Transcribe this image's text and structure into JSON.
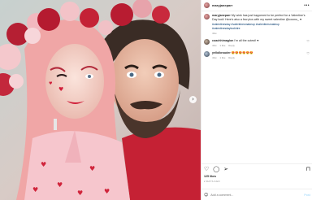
{
  "post": {
    "author": "maryjaneparr",
    "caption_user": "maryjaneparr",
    "caption_text": "My wink has just happened to be perfect for a Valentine's Day look! Here's also a few pics with my sweet valentine @cosmo_ ♥",
    "hashtags": "#valentinesday #valentinesmakeup #valentinesmakeup #valentinesdaylookhire",
    "caption_time": "43w",
    "comments": [
      {
        "user": "coachhimaglon",
        "text": "I'm all the cutest! ♥",
        "time": "43w",
        "likes": "1 like",
        "reply": "Reply"
      },
      {
        "user": "yellolbrouder",
        "text": "😍😍😍😍😍😍",
        "time": "43w",
        "likes": "1 like",
        "reply": "Reply"
      }
    ],
    "likes": "125 likes",
    "date": "2 DAYS AGO",
    "add_comment_placeholder": "Add a comment...",
    "post_label": "Post"
  },
  "icons": {
    "more": "more-dots-icon",
    "heart": "heart-icon",
    "comment": "comment-icon",
    "share": "share-icon",
    "save": "bookmark-icon",
    "emoji": "emoji-icon",
    "next": "chevron-right-icon"
  },
  "colors": {
    "link": "#00376b",
    "heart_red": "#d42a45",
    "post_button": "#b2dffc",
    "muted": "#8e8e8e"
  }
}
